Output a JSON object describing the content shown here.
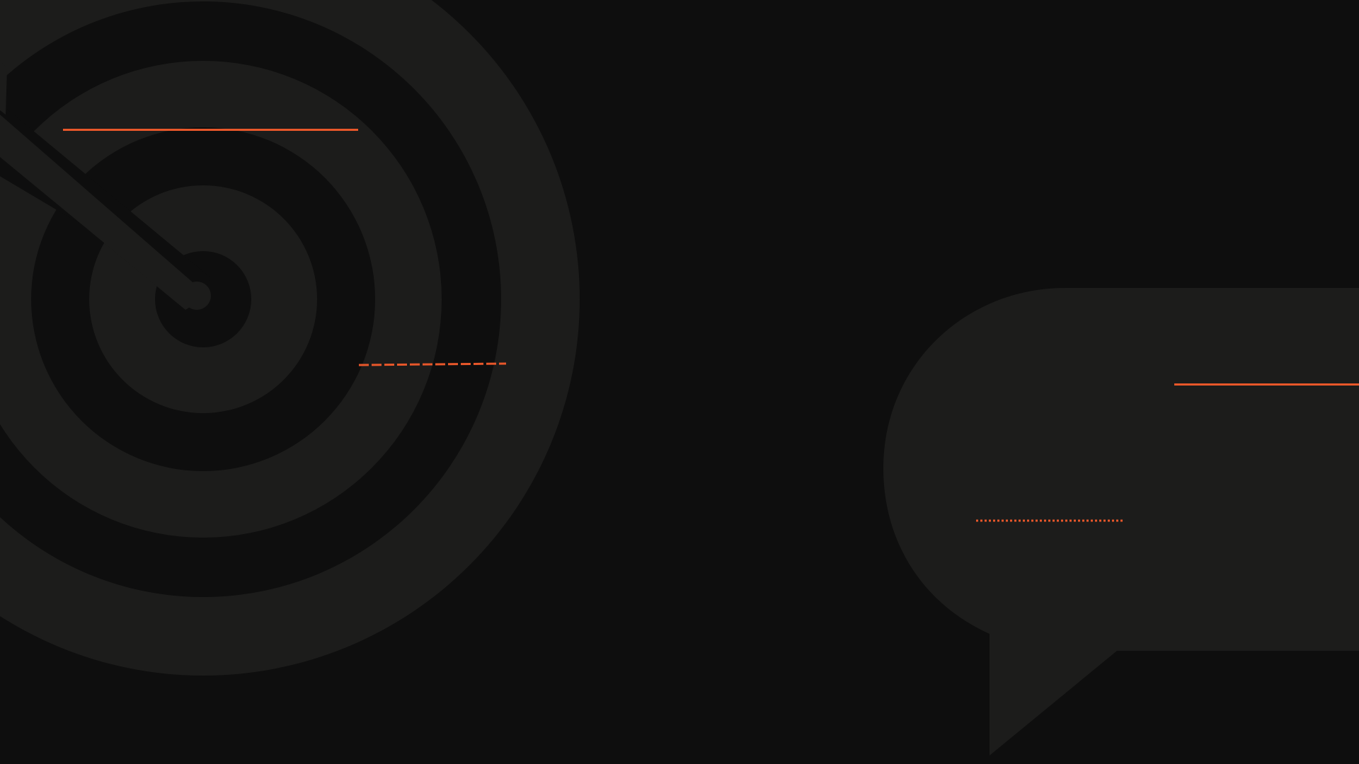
{
  "background": {
    "color": "#0e0e0e"
  },
  "shapes": {
    "fill_color": "#1c1c1b",
    "target_icon": "target-with-arrow-icon",
    "speech_bubble_icon": "speech-bubble-icon"
  },
  "accent": {
    "color": "#e8572a",
    "line_styles": [
      "solid",
      "dashed",
      "solid",
      "dotted"
    ]
  }
}
